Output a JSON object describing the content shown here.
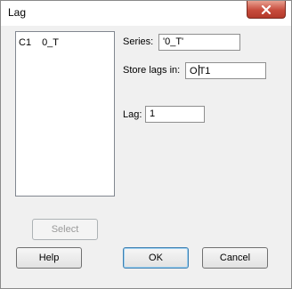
{
  "window": {
    "title": "Lag"
  },
  "columns_list": {
    "items": [
      {
        "column": "C1",
        "name": "0_T"
      }
    ]
  },
  "series": {
    "label": "Series:",
    "value": "'0_T'"
  },
  "store_lags": {
    "label": "Store lags in:",
    "value_before_caret": "O",
    "value_after_caret": "T1"
  },
  "lag": {
    "label": "Lag:",
    "value": "1"
  },
  "buttons": {
    "select": "Select",
    "help": "Help",
    "ok": "OK",
    "cancel": "Cancel"
  },
  "icons": {
    "close": "close-icon"
  }
}
